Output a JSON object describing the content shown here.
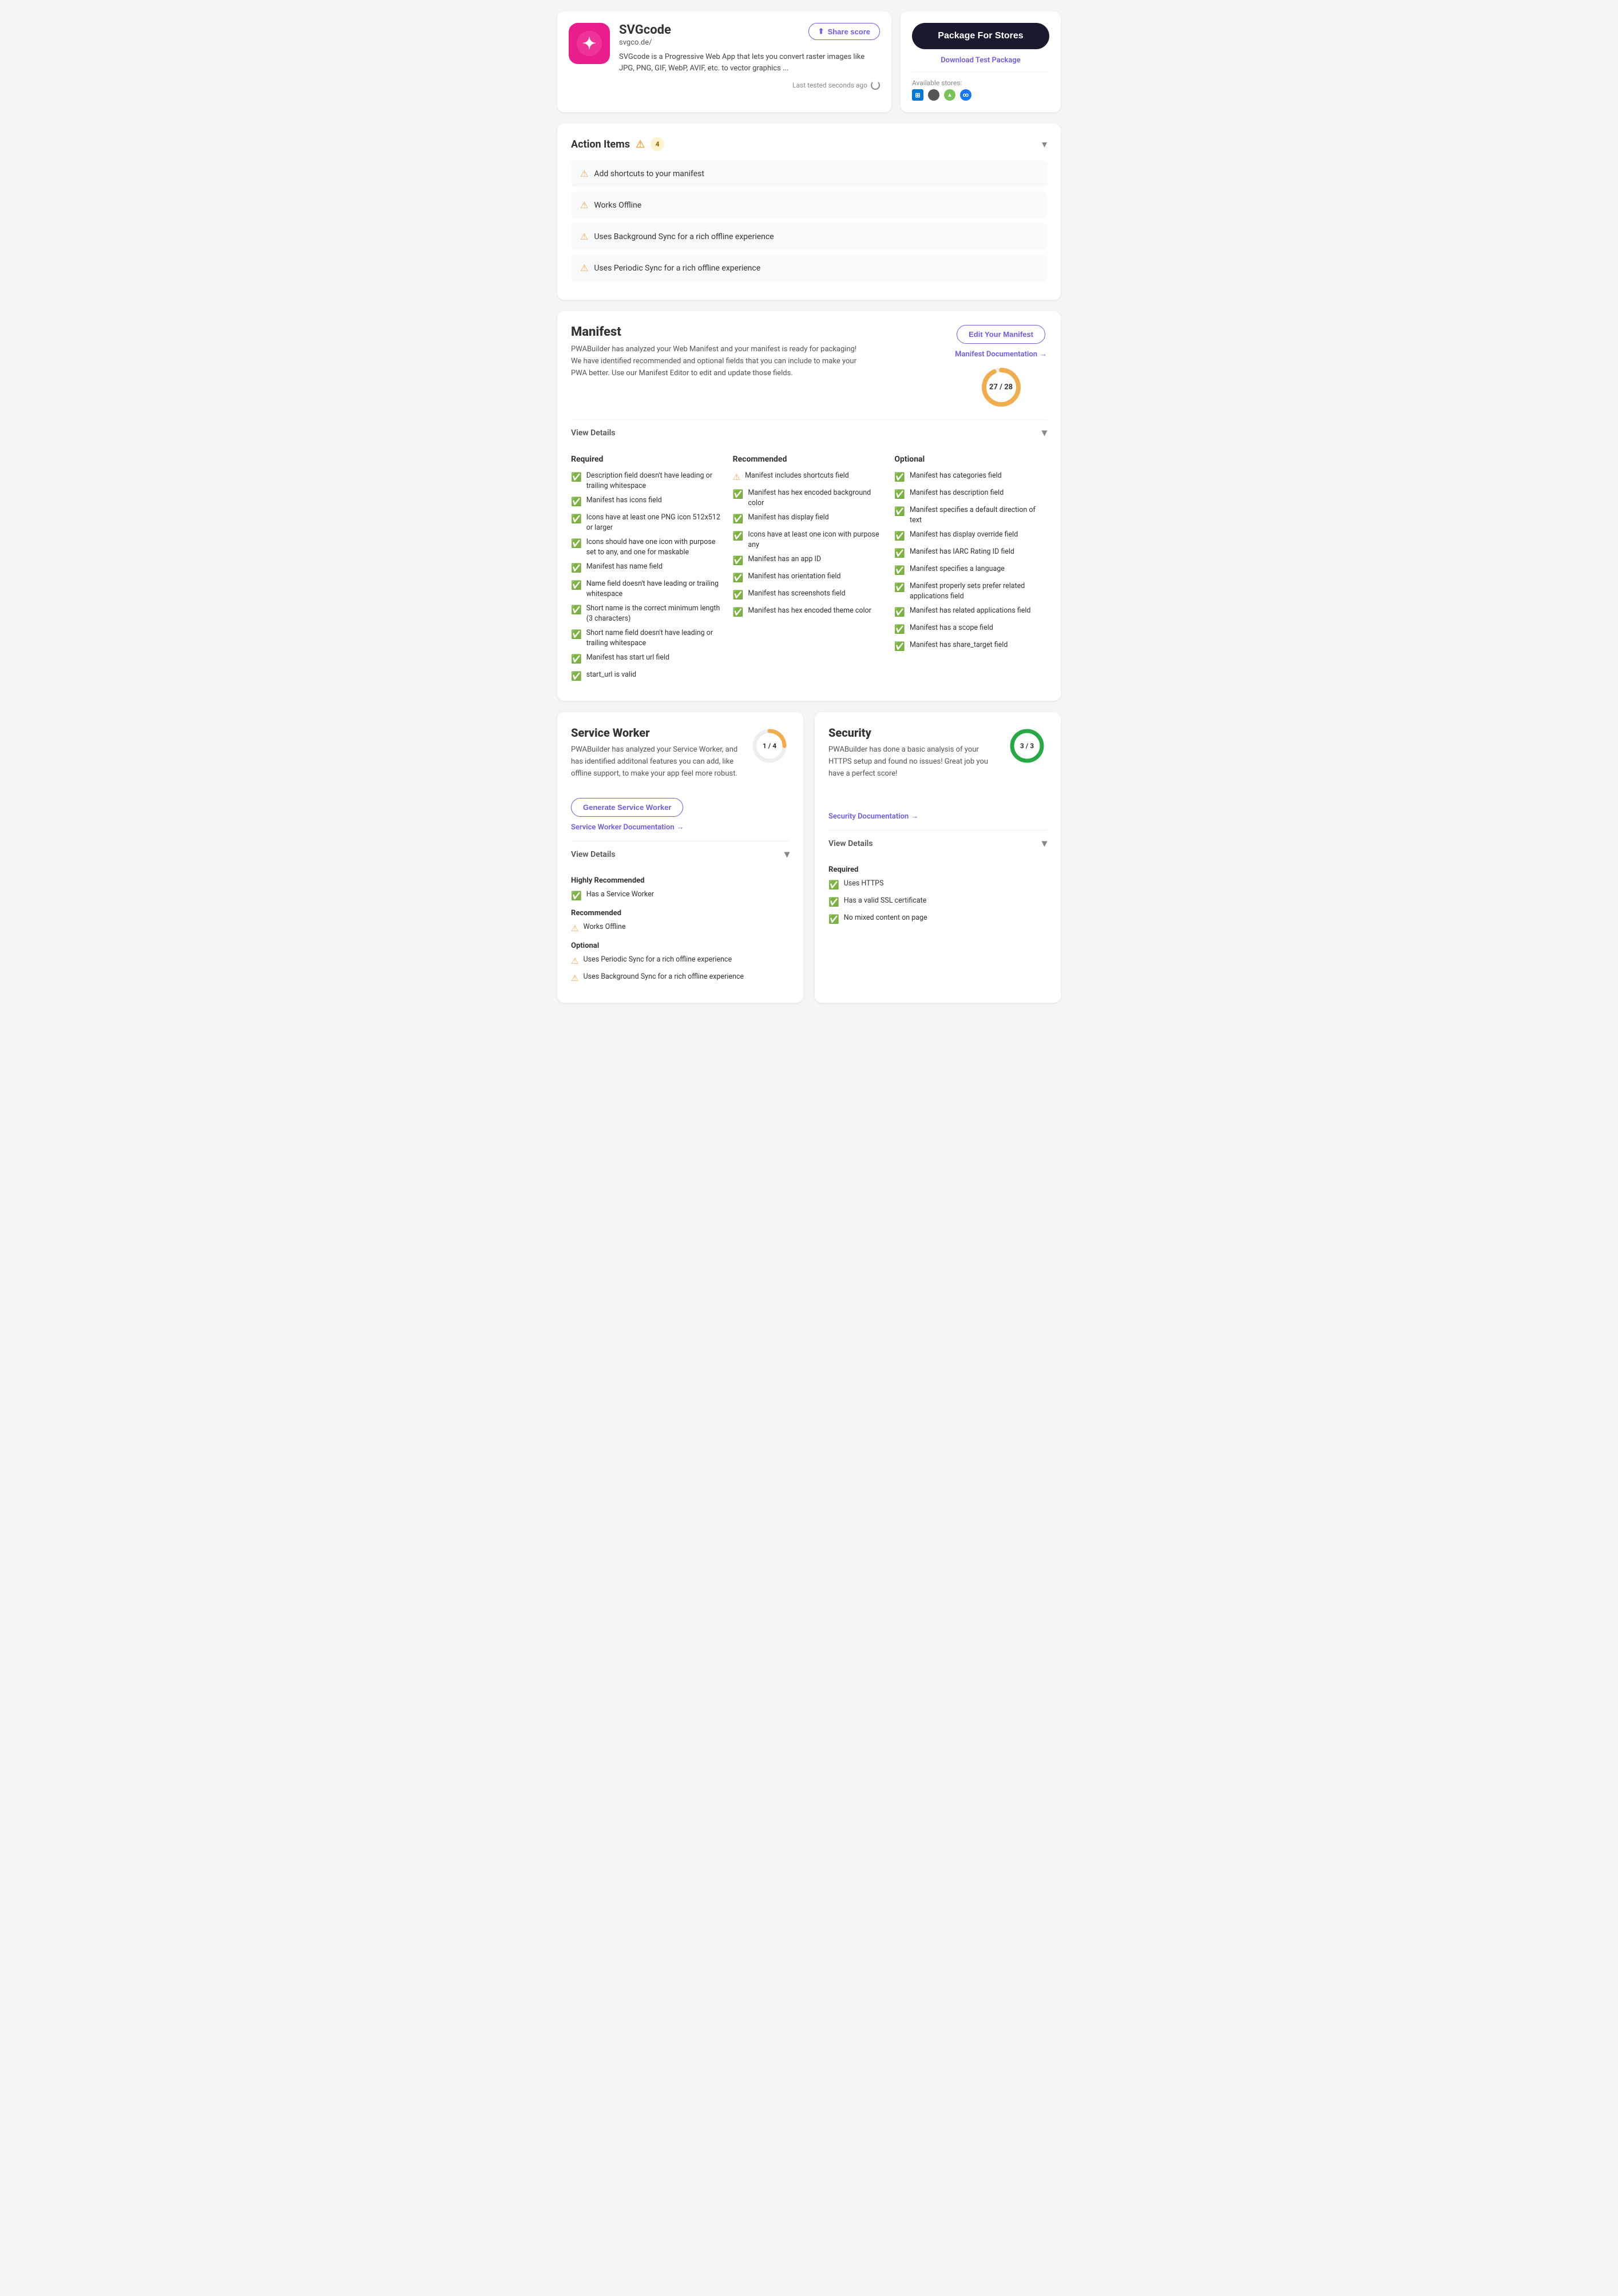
{
  "app": {
    "name": "SVGcode",
    "url": "svgco.de/",
    "description": "SVGcode is a Progressive Web App that lets you convert raster images like JPG, PNG, GIF, WebP, AVIF, etc. to vector graphics ...",
    "last_tested": "Last tested seconds ago"
  },
  "header": {
    "share_btn": "Share score",
    "package_btn": "Package For Stores",
    "download_link": "Download Test Package",
    "available_stores_label": "Available stores:"
  },
  "action_items": {
    "title": "Action Items",
    "count": "4",
    "items": [
      {
        "text": "Add shortcuts to your manifest"
      },
      {
        "text": "Works Offline"
      },
      {
        "text": "Uses Background Sync for a rich offline experience"
      },
      {
        "text": "Uses Periodic Sync for a rich offline experience"
      }
    ]
  },
  "manifest": {
    "title": "Manifest",
    "description": "PWABuilder has analyzed your Web Manifest and your manifest is ready for packaging! We have identified recommended and optional fields that you can include to make your PWA better. Use our Manifest Editor to edit and update those fields.",
    "edit_btn": "Edit Your Manifest",
    "doc_link": "Manifest Documentation",
    "score_current": "27",
    "score_total": "28",
    "score_fraction": 0.964,
    "score_color": "#f0ad4e",
    "view_details": "View Details",
    "required": {
      "title": "Required",
      "items": [
        {
          "status": "green",
          "text": "Description field doesn't have leading or trailing whitespace"
        },
        {
          "status": "green",
          "text": "Manifest has icons field"
        },
        {
          "status": "green",
          "text": "Icons have at least one PNG icon 512x512 or larger"
        },
        {
          "status": "green",
          "text": "Icons should have one icon with purpose set to any, and one for maskable"
        },
        {
          "status": "green",
          "text": "Manifest has name field"
        },
        {
          "status": "green",
          "text": "Name field doesn't have leading or trailing whitespace"
        },
        {
          "status": "green",
          "text": "Short name is the correct minimum length (3 characters)"
        },
        {
          "status": "green",
          "text": "Short name field doesn't have leading or trailing whitespace"
        },
        {
          "status": "green",
          "text": "Manifest has start url field"
        },
        {
          "status": "green",
          "text": "start_url is valid"
        }
      ]
    },
    "recommended": {
      "title": "Recommended",
      "items": [
        {
          "status": "warn",
          "text": "Manifest includes shortcuts field"
        },
        {
          "status": "green",
          "text": "Manifest has hex encoded background color"
        },
        {
          "status": "green",
          "text": "Manifest has display field"
        },
        {
          "status": "green",
          "text": "Icons have at least one icon with purpose any"
        },
        {
          "status": "green",
          "text": "Manifest has an app ID"
        },
        {
          "status": "green",
          "text": "Manifest has orientation field"
        },
        {
          "status": "green",
          "text": "Manifest has screenshots field"
        },
        {
          "status": "green",
          "text": "Manifest has hex encoded theme color"
        }
      ]
    },
    "optional": {
      "title": "Optional",
      "items": [
        {
          "status": "green",
          "text": "Manifest has categories field"
        },
        {
          "status": "green",
          "text": "Manifest has description field"
        },
        {
          "status": "green",
          "text": "Manifest specifies a default direction of text"
        },
        {
          "status": "green",
          "text": "Manifest has display override field"
        },
        {
          "status": "green",
          "text": "Manifest has IARC Rating ID field"
        },
        {
          "status": "green",
          "text": "Manifest specifies a language"
        },
        {
          "status": "green",
          "text": "Manifest properly sets prefer related applications field"
        },
        {
          "status": "green",
          "text": "Manifest has related applications field"
        },
        {
          "status": "green",
          "text": "Manifest has a scope field"
        },
        {
          "status": "green",
          "text": "Manifest has share_target field"
        }
      ]
    }
  },
  "service_worker": {
    "title": "Service Worker",
    "description": "PWABuilder has analyzed your Service Worker, and has identified additonal features you can add, like offline support, to make your app feel more robust.",
    "score_current": "1",
    "score_total": "4",
    "score_fraction": 0.25,
    "score_color": "#f0ad4e",
    "generate_btn": "Generate Service Worker",
    "doc_link": "Service Worker Documentation",
    "view_details": "View Details",
    "highly_recommended": {
      "title": "Highly Recommended",
      "items": [
        {
          "status": "green",
          "text": "Has a Service Worker"
        }
      ]
    },
    "recommended": {
      "title": "Recommended",
      "items": [
        {
          "status": "warn",
          "text": "Works Offline"
        }
      ]
    },
    "optional": {
      "title": "Optional",
      "items": [
        {
          "status": "warn",
          "text": "Uses Periodic Sync for a rich offline experience"
        },
        {
          "status": "warn",
          "text": "Uses Background Sync for a rich offline experience"
        }
      ]
    }
  },
  "security": {
    "title": "Security",
    "description": "PWABuilder has done a basic analysis of your HTTPS setup and found no issues! Great job you have a perfect score!",
    "score_current": "3",
    "score_total": "3",
    "score_fraction": 1.0,
    "score_color": "#28a745",
    "doc_link": "Security Documentation",
    "view_details": "View Details",
    "required": {
      "title": "Required",
      "items": [
        {
          "status": "green",
          "text": "Uses HTTPS"
        },
        {
          "status": "green",
          "text": "Has a valid SSL certificate"
        },
        {
          "status": "green",
          "text": "No mixed content on page"
        }
      ]
    }
  }
}
